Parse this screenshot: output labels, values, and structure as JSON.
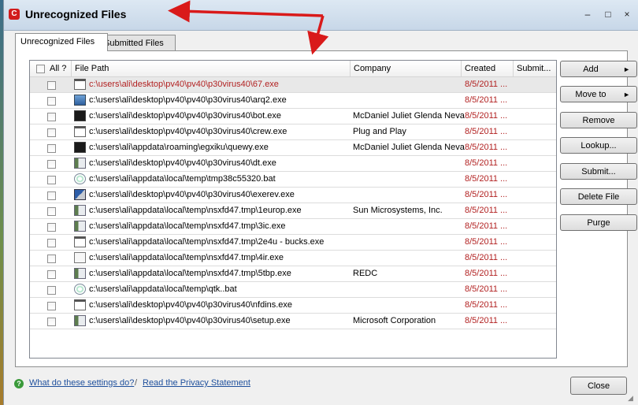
{
  "window": {
    "title": "Unrecognized Files",
    "app_icon_letter": "C",
    "controls": {
      "minimize": "–",
      "maximize": "□",
      "close": "×"
    }
  },
  "tabs": [
    {
      "label": "Unrecognized Files",
      "active": true
    },
    {
      "label": "Submitted Files",
      "active": false
    }
  ],
  "table": {
    "columns": {
      "all": "All ?",
      "path": "File Path",
      "company": "Company",
      "created": "Created",
      "submitted": "Submit..."
    },
    "rows": [
      {
        "icon": "window-icon",
        "path": "c:\\users\\ali\\desktop\\pv40\\pv40\\p30virus40\\67.exe",
        "company": "",
        "created": "8/5/2011 ...",
        "selected": true
      },
      {
        "icon": "blue-app-icon",
        "path": "c:\\users\\ali\\desktop\\pv40\\pv40\\p30virus40\\arq2.exe",
        "company": "",
        "created": "8/5/2011 ...",
        "selected": false
      },
      {
        "icon": "dark-app-icon",
        "path": "c:\\users\\ali\\desktop\\pv40\\pv40\\p30virus40\\bot.exe",
        "company": "McDaniel Juliet Glenda Neva",
        "created": "8/5/2011 ...",
        "selected": false
      },
      {
        "icon": "window-icon",
        "path": "c:\\users\\ali\\desktop\\pv40\\pv40\\p30virus40\\crew.exe",
        "company": "Plug and Play",
        "created": "8/5/2011 ...",
        "selected": false
      },
      {
        "icon": "dark-app-icon",
        "path": "c:\\users\\ali\\appdata\\roaming\\egxiku\\quewy.exe",
        "company": "McDaniel Juliet Glenda Neva",
        "created": "8/5/2011 ...",
        "selected": false
      },
      {
        "icon": "app-icon",
        "path": "c:\\users\\ali\\desktop\\pv40\\pv40\\p30virus40\\dt.exe",
        "company": "",
        "created": "8/5/2011 ...",
        "selected": false
      },
      {
        "icon": "gear-icon",
        "path": "c:\\users\\ali\\appdata\\local\\temp\\tmp38c55320.bat",
        "company": "",
        "created": "8/5/2011 ...",
        "selected": false
      },
      {
        "icon": "network-icon",
        "path": "c:\\users\\ali\\desktop\\pv40\\pv40\\p30virus40\\exerev.exe",
        "company": "",
        "created": "8/5/2011 ...",
        "selected": false
      },
      {
        "icon": "app-icon",
        "path": "c:\\users\\ali\\appdata\\local\\temp\\nsxfd47.tmp\\1europ.exe",
        "company": "Sun Microsystems, Inc.",
        "created": "8/5/2011 ...",
        "selected": false
      },
      {
        "icon": "app-icon",
        "path": "c:\\users\\ali\\appdata\\local\\temp\\nsxfd47.tmp\\3ic.exe",
        "company": "",
        "created": "8/5/2011 ...",
        "selected": false
      },
      {
        "icon": "window-icon",
        "path": "c:\\users\\ali\\appdata\\local\\temp\\nsxfd47.tmp\\2e4u - bucks.exe",
        "company": "",
        "created": "8/5/2011 ...",
        "selected": false
      },
      {
        "icon": "document-icon",
        "path": "c:\\users\\ali\\appdata\\local\\temp\\nsxfd47.tmp\\4ir.exe",
        "company": "",
        "created": "8/5/2011 ...",
        "selected": false
      },
      {
        "icon": "app-icon",
        "path": "c:\\users\\ali\\appdata\\local\\temp\\nsxfd47.tmp\\5tbp.exe",
        "company": "REDC",
        "created": "8/5/2011 ...",
        "selected": false
      },
      {
        "icon": "gear-icon",
        "path": "c:\\users\\ali\\appdata\\local\\temp\\qtk..bat",
        "company": "",
        "created": "8/5/2011 ...",
        "selected": false
      },
      {
        "icon": "window-icon",
        "path": "c:\\users\\ali\\desktop\\pv40\\pv40\\p30virus40\\nfdins.exe",
        "company": "",
        "created": "8/5/2011 ...",
        "selected": false
      },
      {
        "icon": "app-icon",
        "path": "c:\\users\\ali\\desktop\\pv40\\pv40\\p30virus40\\setup.exe",
        "company": "Microsoft Corporation",
        "created": "8/5/2011 ...",
        "selected": false
      }
    ]
  },
  "buttons": {
    "add": "Add",
    "move_to": "Move to",
    "remove": "Remove",
    "lookup": "Lookup...",
    "submit": "Submit...",
    "delete_file": "Delete File",
    "purge": "Purge",
    "close": "Close",
    "submenu_arrow": "►"
  },
  "footer": {
    "help_icon": "?",
    "settings_link": "What do these settings do?",
    "separator": "/",
    "privacy_link": "Read the Privacy Statement"
  },
  "colors": {
    "selected_text": "#b22222",
    "link": "#1e4f9c",
    "annotation_arrow": "#d91a1a"
  }
}
